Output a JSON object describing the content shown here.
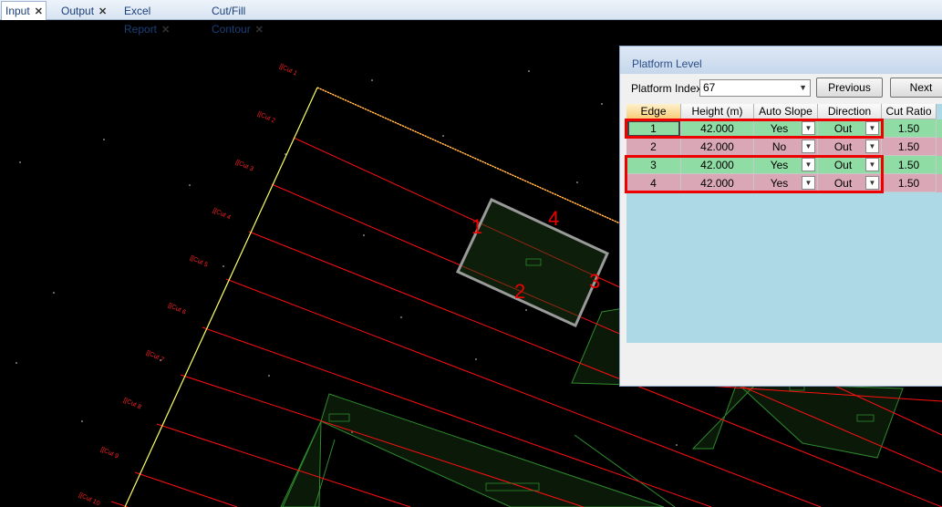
{
  "tabs": [
    {
      "label": "Input",
      "close": "✕",
      "active": true
    },
    {
      "label": "Output",
      "close": "✕",
      "active": false
    },
    {
      "label": "Excel Report",
      "close": "✕",
      "active": false
    },
    {
      "label": "Cut/Fill Contour",
      "close": "✕",
      "active": false
    }
  ],
  "colors": {
    "background": "#000000",
    "section_line": "#ff1010",
    "alignment_line": "#ffff66",
    "platform_outline": "#999999",
    "parcel_line": "#2e8b2e",
    "highlight_box": "#e00000",
    "row_green": "#8fdca4",
    "row_pink": "#d9a7b6",
    "grid_background": "#add8e6"
  },
  "canvas": {
    "section_labels": [
      "[[Cut 1",
      "[[Cut 2",
      "[[Cut 3",
      "[[Cut 4",
      "[[Cut 5",
      "[[Cut 6",
      "[[Cut 7",
      "[[Cut 8",
      "[[Cut 9",
      "[[Cut 10"
    ],
    "edge_markers": [
      "1",
      "2",
      "3",
      "4"
    ]
  },
  "dialog": {
    "title": "Platform Level",
    "platform_index_label": "Platform Index",
    "platform_index_value": "67",
    "previous_label": "Previous",
    "next_label": "Next",
    "columns": [
      "Edge",
      "Height (m)",
      "Auto Slope",
      "Direction",
      "Cut Ratio"
    ],
    "rows": [
      {
        "edge": "1",
        "height": "42.000",
        "auto_slope": "Yes",
        "direction": "Out",
        "cut_ratio": "1.50",
        "color": "green"
      },
      {
        "edge": "2",
        "height": "42.000",
        "auto_slope": "No",
        "direction": "Out",
        "cut_ratio": "1.50",
        "color": "pink"
      },
      {
        "edge": "3",
        "height": "42.000",
        "auto_slope": "Yes",
        "direction": "Out",
        "cut_ratio": "1.50",
        "color": "green"
      },
      {
        "edge": "4",
        "height": "42.000",
        "auto_slope": "Yes",
        "direction": "Out",
        "cut_ratio": "1.50",
        "color": "pink"
      }
    ]
  }
}
